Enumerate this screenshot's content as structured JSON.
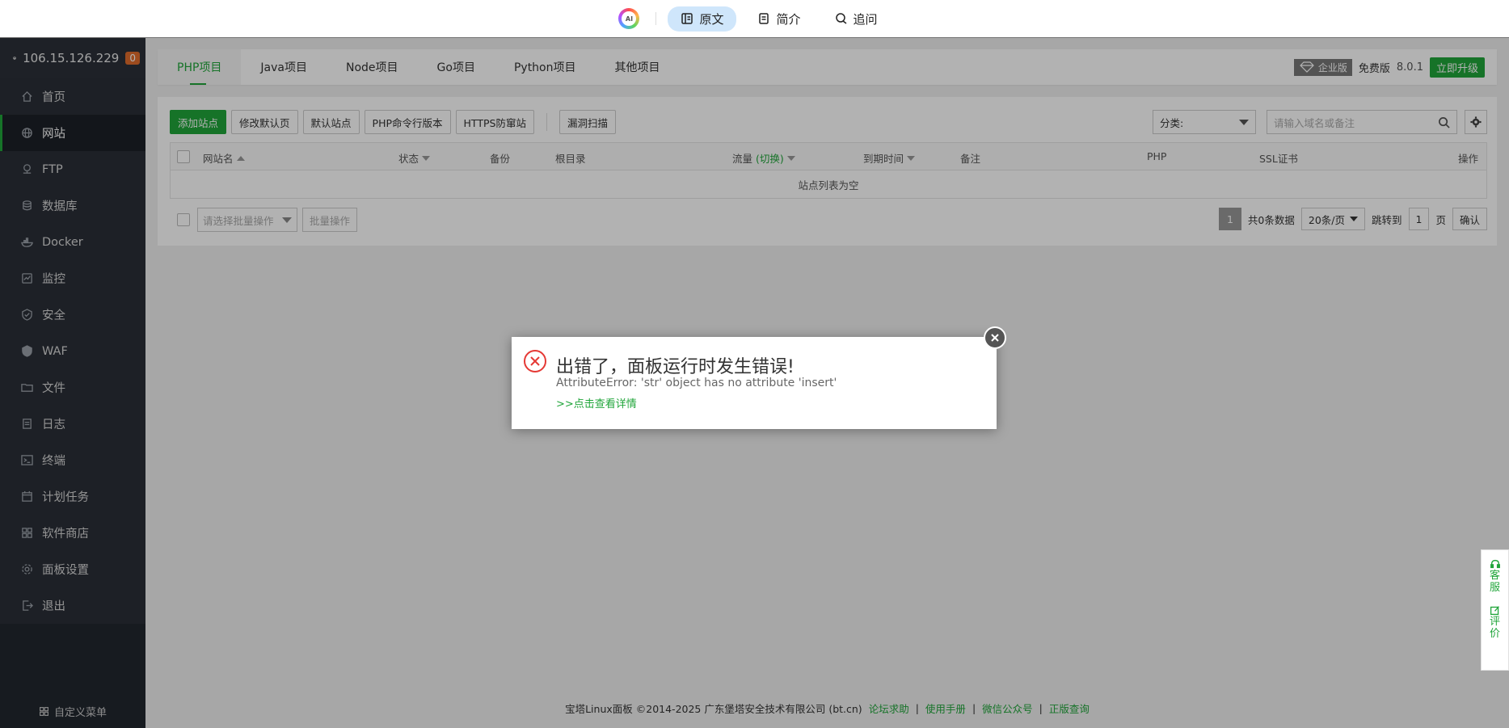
{
  "reader_bar": {
    "ai_logo": "AI",
    "tabs": [
      {
        "label": "原文",
        "active": true
      },
      {
        "label": "简介",
        "active": false
      },
      {
        "label": "追问",
        "active": false
      }
    ]
  },
  "sidebar": {
    "server_ip": "106.15.126.229",
    "badge": "0",
    "items": [
      {
        "label": "首页",
        "icon": "home-icon"
      },
      {
        "label": "网站",
        "icon": "globe-icon",
        "active": true
      },
      {
        "label": "FTP",
        "icon": "ftp-icon"
      },
      {
        "label": "数据库",
        "icon": "database-icon"
      },
      {
        "label": "Docker",
        "icon": "docker-icon"
      },
      {
        "label": "监控",
        "icon": "monitor-icon"
      },
      {
        "label": "安全",
        "icon": "shield-icon"
      },
      {
        "label": "WAF",
        "icon": "waf-icon"
      },
      {
        "label": "文件",
        "icon": "folder-icon"
      },
      {
        "label": "日志",
        "icon": "log-icon"
      },
      {
        "label": "终端",
        "icon": "terminal-icon"
      },
      {
        "label": "计划任务",
        "icon": "calendar-icon"
      },
      {
        "label": "软件商店",
        "icon": "apps-icon"
      },
      {
        "label": "面板设置",
        "icon": "gear-icon"
      },
      {
        "label": "退出",
        "icon": "logout-icon"
      }
    ],
    "custom_menu": "自定义菜单"
  },
  "project_tabs": [
    "PHP项目",
    "Java项目",
    "Node项目",
    "Go项目",
    "Python项目",
    "其他项目"
  ],
  "edition": {
    "enterprise": "企业版",
    "free": "免费版",
    "version": "8.0.1",
    "upgrade": "立即升级"
  },
  "toolbar": {
    "add_site": "添加站点",
    "edit_default_page": "修改默认页",
    "default_site": "默认站点",
    "php_cli": "PHP命令行版本",
    "https_guard": "HTTPS防窜站",
    "vuln_scan": "漏洞扫描",
    "category": "分类:",
    "search_placeholder": "请输入域名或备注"
  },
  "table": {
    "columns": {
      "name": "网站名",
      "status": "状态",
      "backup": "备份",
      "root": "根目录",
      "traffic": "流量",
      "traffic_switch": "(切换)",
      "expire": "到期时间",
      "remark": "备注",
      "php": "PHP",
      "ssl": "SSL证书",
      "action": "操作"
    },
    "empty_text": "站点列表为空"
  },
  "pagination": {
    "batch_placeholder": "请选择批量操作",
    "batch_button": "批量操作",
    "current_page": "1",
    "total": "共0条数据",
    "per_page": "20条/页",
    "jump_label": "跳转到",
    "jump_value": "1",
    "page_unit": "页",
    "confirm": "确认"
  },
  "footer": {
    "copyright": "宝塔Linux面板 ©2014-2025 广东堡塔安全技术有限公司 (bt.cn)",
    "links": [
      "论坛求助",
      "使用手册",
      "微信公众号",
      "正版查询"
    ],
    "separator": "|"
  },
  "dialog": {
    "title": "出错了，面板运行时发生错误!",
    "message": "AttributeError: 'str' object has no attribute 'insert'",
    "link": ">>点击查看详情"
  },
  "float_panel": {
    "service": [
      "客",
      "服"
    ],
    "review": [
      "评",
      "价"
    ]
  },
  "colors": {
    "accent": "#20a53a",
    "sidebar_bg": "#22272f",
    "badge": "#e06c2b",
    "error": "#e53935"
  }
}
